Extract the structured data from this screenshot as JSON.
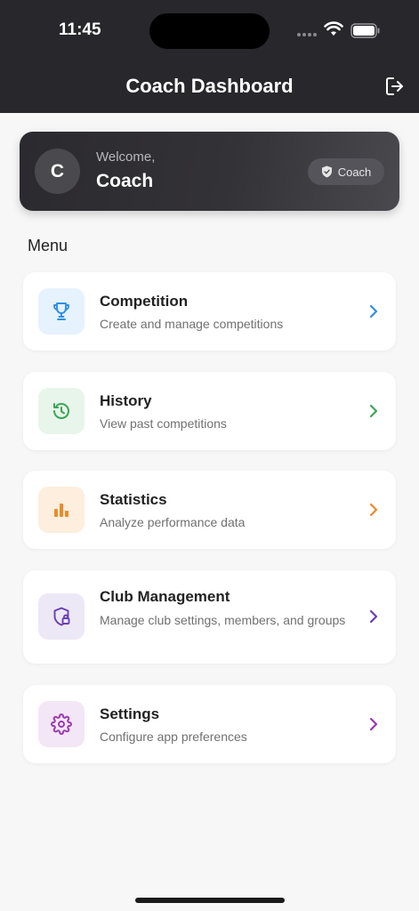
{
  "status_bar": {
    "time": "11:45"
  },
  "header": {
    "title": "Coach Dashboard"
  },
  "welcome": {
    "avatar_initial": "C",
    "greeting": "Welcome,",
    "name": "Coach",
    "role_badge": "Coach"
  },
  "menu": {
    "heading": "Menu",
    "items": [
      {
        "title": "Competition",
        "subtitle": "Create and manage competitions",
        "icon": "trophy-icon",
        "accent": "#2e8fe6",
        "tint": "#e6f2fd"
      },
      {
        "title": "History",
        "subtitle": "View past competitions",
        "icon": "history-icon",
        "accent": "#3aa657",
        "tint": "#e8f5ea"
      },
      {
        "title": "Statistics",
        "subtitle": "Analyze performance data",
        "icon": "bar-chart-icon",
        "accent": "#ee8a2a",
        "tint": "#fdeedd"
      },
      {
        "title": "Club Management",
        "subtitle": "Manage club settings, members, and groups",
        "icon": "shield-lock-icon",
        "accent": "#6a3fb4",
        "tint": "#ede8f6"
      },
      {
        "title": "Settings",
        "subtitle": "Configure app preferences",
        "icon": "gear-icon",
        "accent": "#9b35b1",
        "tint": "#f3e6f6"
      }
    ]
  }
}
